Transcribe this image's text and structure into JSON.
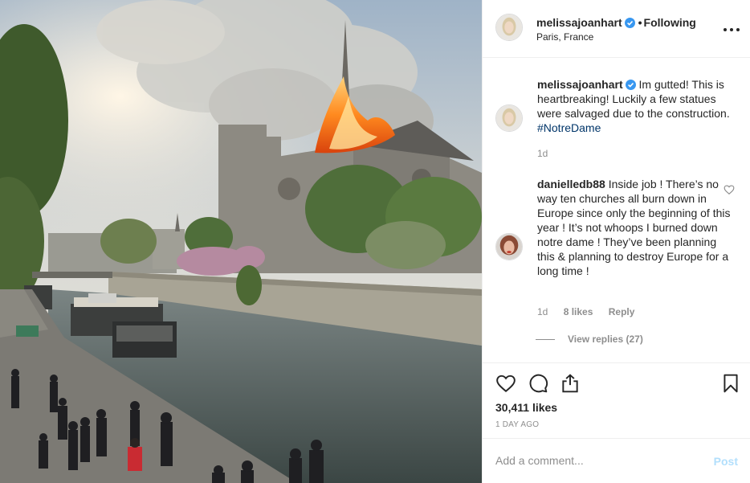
{
  "header": {
    "username": "melissajoanhart",
    "follow_state": "Following",
    "location": "Paris, France"
  },
  "comments": [
    {
      "username": "melissajoanhart",
      "text": " Im gutted! This is heartbreaking! Luckily a few statues were salvaged due to the construction. ",
      "hashtag": "#NotreDame",
      "time": "1d"
    },
    {
      "username": "danielledb88",
      "text": " Inside job ! There’s no way ten churches all burn down in Europe since only the beginning of this year ! It’s not whoops I burned down notre dame ! They’ve been planning this & planning to destroy Europe for a long time !",
      "time": "1d",
      "likes": "8 likes",
      "reply_label": "Reply",
      "view_replies": "View replies (27)"
    }
  ],
  "actions": {
    "likes": "30,411 likes",
    "time_ago": "1 day ago"
  },
  "add_comment": {
    "placeholder": "Add a comment...",
    "post_label": "Post"
  },
  "colors": {
    "verified": "#3897f0",
    "hashtag": "#003569",
    "secondary_text": "#8e8e8e",
    "post_disabled": "#b2dffc"
  }
}
